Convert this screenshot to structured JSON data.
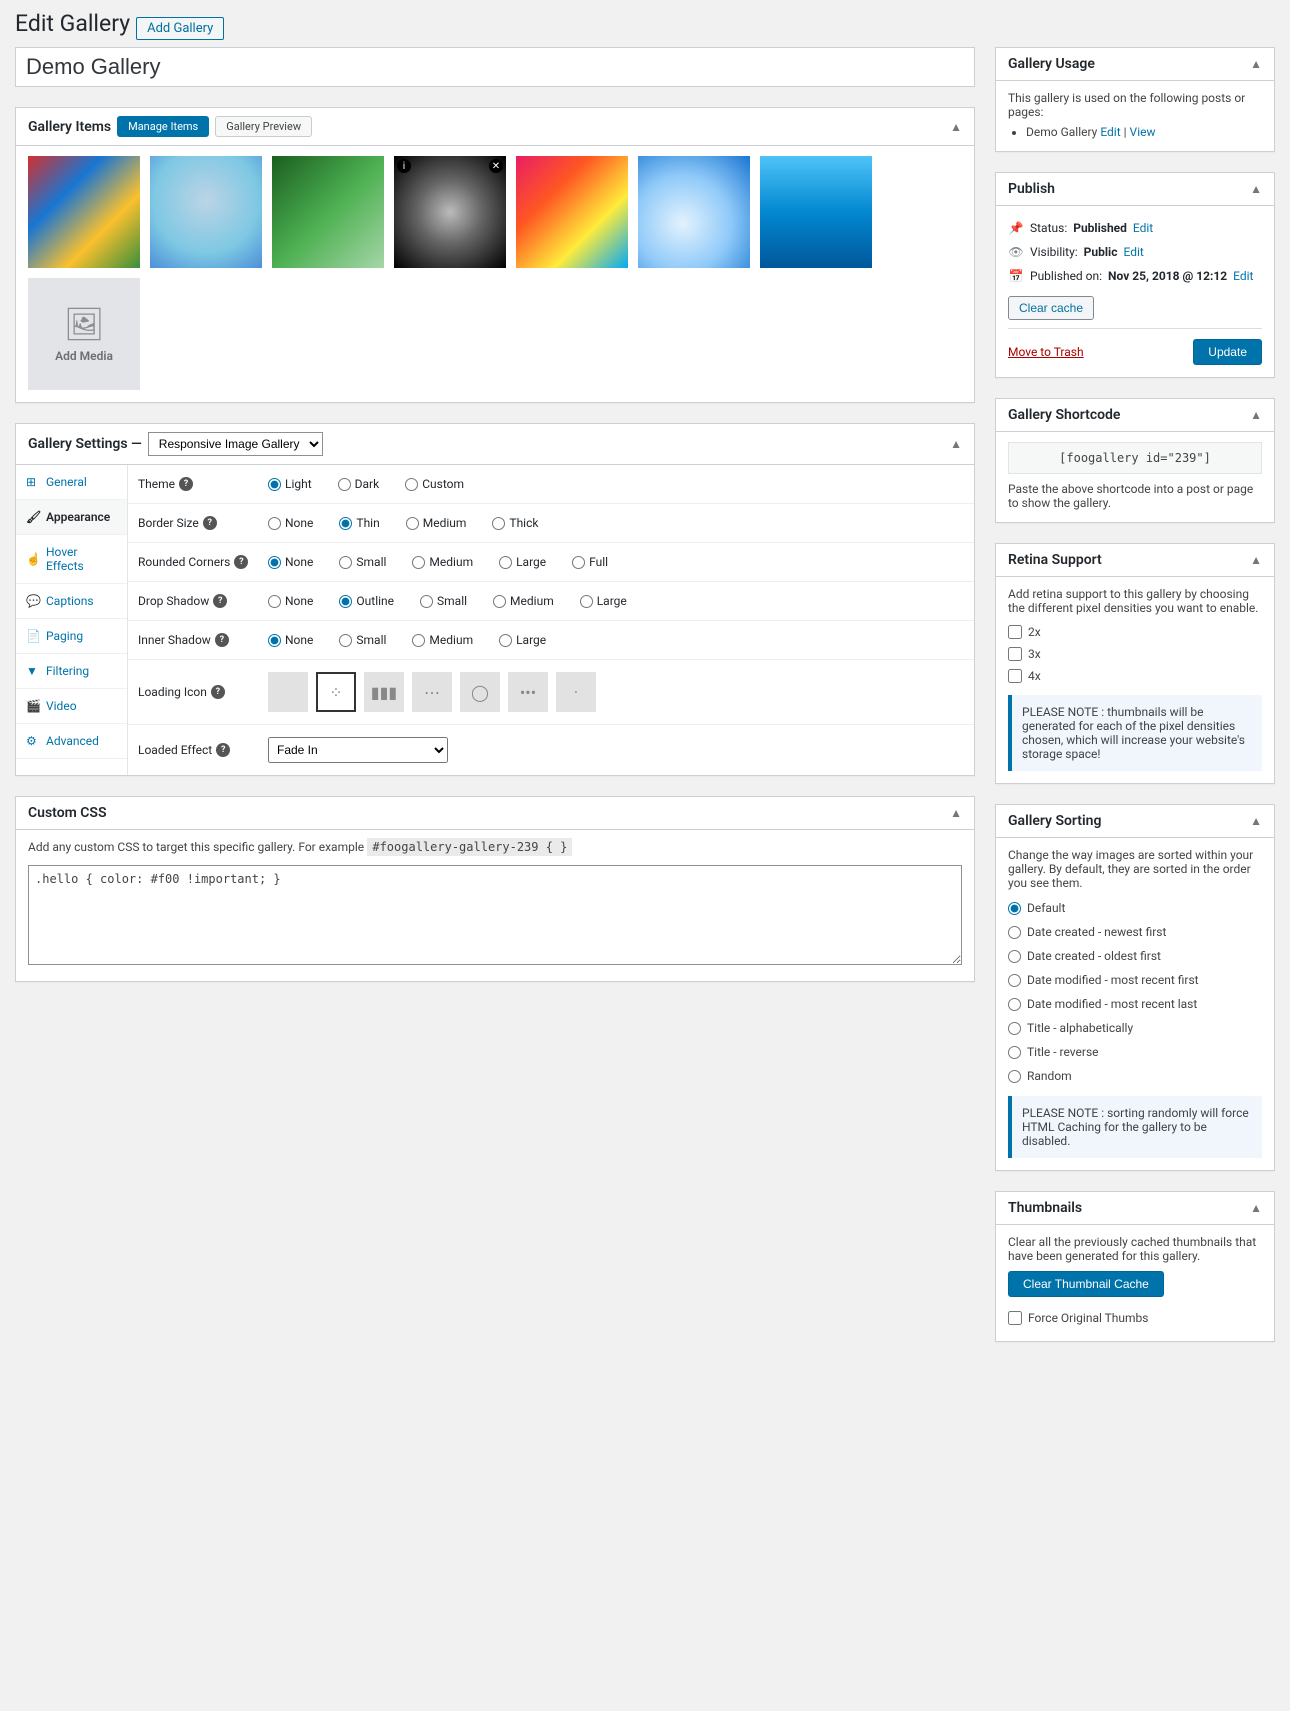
{
  "page": {
    "title": "Edit Gallery",
    "add_new": "Add Gallery",
    "gallery_name": "Demo Gallery"
  },
  "gallery_items": {
    "heading": "Gallery Items",
    "tabs": {
      "manage": "Manage Items",
      "preview": "Gallery Preview"
    },
    "add_media": "Add Media"
  },
  "settings": {
    "heading": "Gallery Settings —",
    "template_options": [
      "Responsive Image Gallery"
    ],
    "template_selected": "Responsive Image Gallery",
    "tabs": [
      {
        "id": "general",
        "label": "General",
        "icon": "⊞"
      },
      {
        "id": "appearance",
        "label": "Appearance",
        "icon": "🖌"
      },
      {
        "id": "hover",
        "label": "Hover Effects",
        "icon": "☝"
      },
      {
        "id": "captions",
        "label": "Captions",
        "icon": "💬"
      },
      {
        "id": "paging",
        "label": "Paging",
        "icon": "📄"
      },
      {
        "id": "filtering",
        "label": "Filtering",
        "icon": "▼"
      },
      {
        "id": "video",
        "label": "Video",
        "icon": "🎬"
      },
      {
        "id": "advanced",
        "label": "Advanced",
        "icon": "⚙"
      }
    ],
    "rows": {
      "theme": {
        "label": "Theme",
        "options": [
          "Light",
          "Dark",
          "Custom"
        ],
        "selected": "Light"
      },
      "border": {
        "label": "Border Size",
        "options": [
          "None",
          "Thin",
          "Medium",
          "Thick"
        ],
        "selected": "Thin"
      },
      "rounded": {
        "label": "Rounded Corners",
        "options": [
          "None",
          "Small",
          "Medium",
          "Large",
          "Full"
        ],
        "selected": "None"
      },
      "dropshadow": {
        "label": "Drop Shadow",
        "options": [
          "None",
          "Outline",
          "Small",
          "Medium",
          "Large"
        ],
        "selected": "Outline"
      },
      "innershadow": {
        "label": "Inner Shadow",
        "options": [
          "None",
          "Small",
          "Medium",
          "Large"
        ],
        "selected": "None"
      },
      "loading": {
        "label": "Loading Icon"
      },
      "effect": {
        "label": "Loaded Effect",
        "options": [
          "Fade In"
        ],
        "selected": "Fade In"
      }
    }
  },
  "custom_css": {
    "heading": "Custom CSS",
    "note": "Add any custom CSS to target this specific gallery. For example",
    "example": "#foogallery-gallery-239 { }",
    "value": ".hello { color: #f00 !important; }"
  },
  "usage": {
    "heading": "Gallery Usage",
    "text": "This gallery is used on the following posts or pages:",
    "items": [
      {
        "title": "Demo Gallery",
        "edit": "Edit",
        "view": "View"
      }
    ]
  },
  "publish": {
    "heading": "Publish",
    "status_label": "Status:",
    "status": "Published",
    "status_edit": "Edit",
    "visibility_label": "Visibility:",
    "visibility": "Public",
    "visibility_edit": "Edit",
    "published_label": "Published on:",
    "published": "Nov 25, 2018 @ 12:12",
    "published_edit": "Edit",
    "clear_cache": "Clear cache",
    "trash": "Move to Trash",
    "update": "Update"
  },
  "shortcode": {
    "heading": "Gallery Shortcode",
    "code": "[foogallery id=\"239\"]",
    "note": "Paste the above shortcode into a post or page to show the gallery."
  },
  "retina": {
    "heading": "Retina Support",
    "text": "Add retina support to this gallery by choosing the different pixel densities you want to enable.",
    "options": [
      "2x",
      "3x",
      "4x"
    ],
    "note": "PLEASE NOTE : thumbnails will be generated for each of the pixel densities chosen, which will increase your website's storage space!"
  },
  "sorting": {
    "heading": "Gallery Sorting",
    "text": "Change the way images are sorted within your gallery. By default, they are sorted in the order you see them.",
    "options": [
      "Default",
      "Date created - newest first",
      "Date created - oldest first",
      "Date modified - most recent first",
      "Date modified - most recent last",
      "Title - alphabetically",
      "Title - reverse",
      "Random"
    ],
    "selected": "Default",
    "note": "PLEASE NOTE : sorting randomly will force HTML Caching for the gallery to be disabled."
  },
  "thumbnails": {
    "heading": "Thumbnails",
    "text": "Clear all the previously cached thumbnails that have been generated for this gallery.",
    "button": "Clear Thumbnail Cache",
    "force": "Force Original Thumbs"
  }
}
